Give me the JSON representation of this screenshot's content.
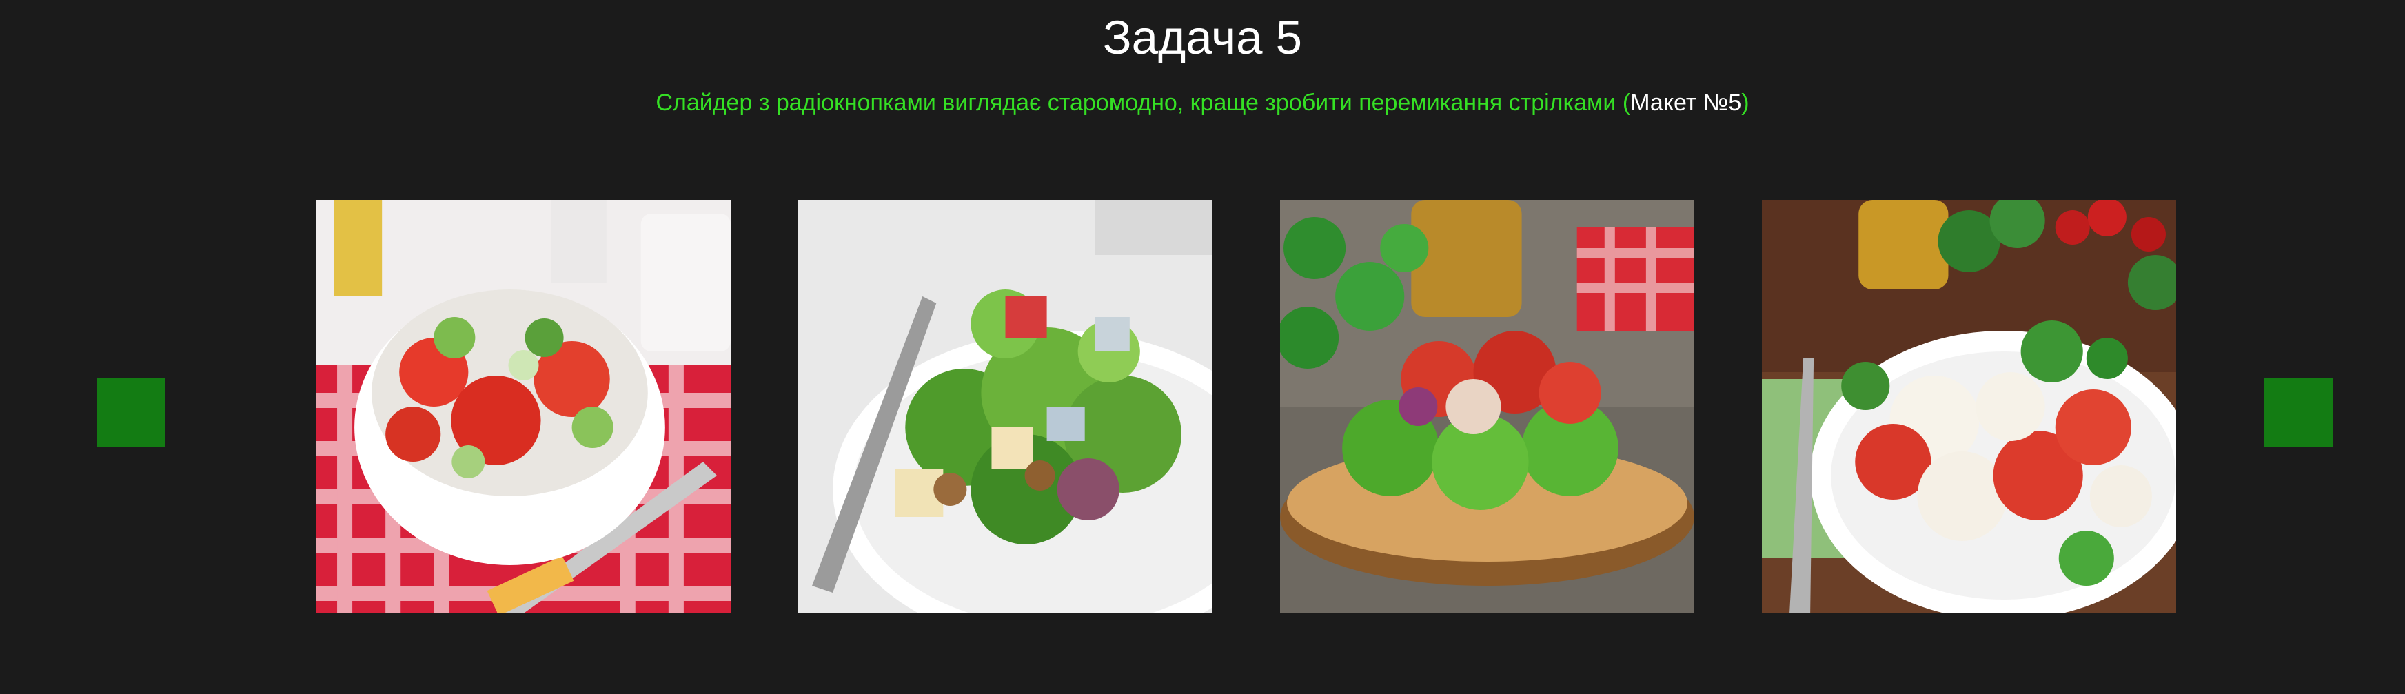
{
  "page": {
    "title": "Задача 5",
    "subtitle_text": "Слайдер з радіокнопками виглядає старомодно, краще зробити перемикання стрілками (",
    "subtitle_link": "Макет №5",
    "subtitle_end": ")"
  },
  "slider": {
    "prev_label": "",
    "next_label": "",
    "slides": [
      {
        "name": "tomato-cucumber-salad-bowl"
      },
      {
        "name": "green-salad-apple-walnut-blue-cheese"
      },
      {
        "name": "tomato-salad-on-wood-slice"
      },
      {
        "name": "caprese-salad-plate"
      }
    ]
  },
  "colors": {
    "background": "#1b1b1b",
    "accent_green": "#35e024",
    "arrow_green": "#137c13",
    "title": "#ffffff"
  }
}
